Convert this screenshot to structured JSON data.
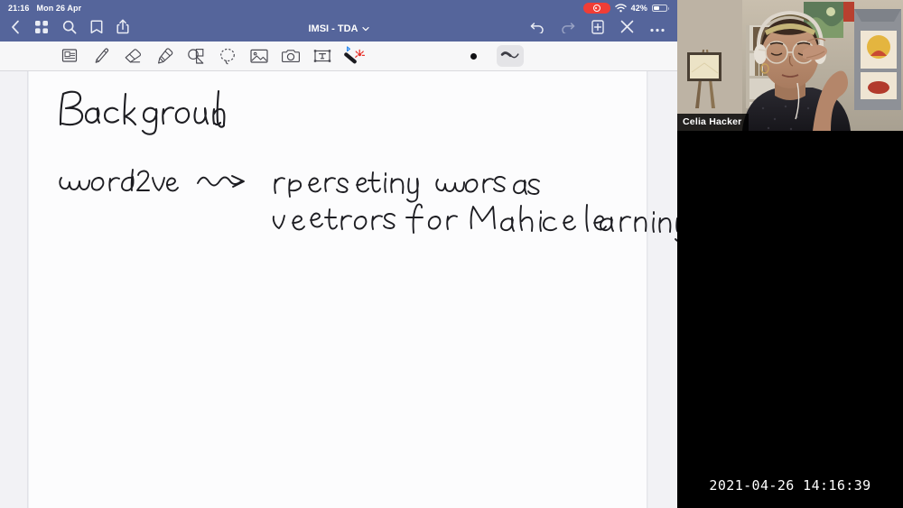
{
  "status_bar": {
    "time": "21:16",
    "date": "Mon 26 Apr",
    "battery_percent": "42%",
    "battery_level": 42,
    "recording_icon": "record-indicator",
    "wifi_icon": "wifi-icon"
  },
  "nav_bar": {
    "title": "IMSI - TDA",
    "title_chevron_icon": "chevron-down-icon",
    "left_icons": [
      {
        "name": "back-icon",
        "label": "Back"
      },
      {
        "name": "grid-view-icon",
        "label": "Page Grid"
      },
      {
        "name": "search-icon",
        "label": "Search"
      },
      {
        "name": "bookmark-icon",
        "label": "Bookmark"
      },
      {
        "name": "share-icon",
        "label": "Share"
      }
    ],
    "right_icons": [
      {
        "name": "undo-icon",
        "label": "Undo",
        "enabled": true
      },
      {
        "name": "redo-icon",
        "label": "Redo",
        "enabled": false
      },
      {
        "name": "add-page-icon",
        "label": "Add Page",
        "enabled": true
      },
      {
        "name": "close-icon",
        "label": "Close",
        "enabled": true
      },
      {
        "name": "more-icon",
        "label": "More",
        "enabled": true
      }
    ]
  },
  "tool_bar": {
    "tools": [
      {
        "name": "page-layout-icon",
        "label": "Page Layout",
        "selected": false
      },
      {
        "name": "pen-icon",
        "label": "Pen",
        "selected": false
      },
      {
        "name": "eraser-icon",
        "label": "Eraser",
        "selected": false
      },
      {
        "name": "highlighter-icon",
        "label": "Highlighter",
        "selected": false
      },
      {
        "name": "shapes-icon",
        "label": "Shapes",
        "selected": false
      },
      {
        "name": "lasso-icon",
        "label": "Lasso Select",
        "selected": false
      },
      {
        "name": "image-icon",
        "label": "Insert Image",
        "selected": false
      },
      {
        "name": "camera-icon",
        "label": "Camera",
        "selected": false
      },
      {
        "name": "text-box-icon",
        "label": "Text Box",
        "selected": false
      },
      {
        "name": "stylus-bluetooth-icon",
        "label": "Stylus Connected",
        "selected": false
      }
    ],
    "color_swatch": "#111114",
    "stroke_style": {
      "name": "stroke-preview-icon",
      "label": "Stroke Style",
      "selected": true
    }
  },
  "note": {
    "heading": "Background",
    "term": "word2vec",
    "arrow_icon": "squiggly-arrow-icon",
    "definition_line_1": "representing words as",
    "definition_line_2": "vectors for Machine learning tasks"
  },
  "video": {
    "participant_name": "Celia Hacker",
    "timestamp": "2021-04-26 14:16:39"
  }
}
